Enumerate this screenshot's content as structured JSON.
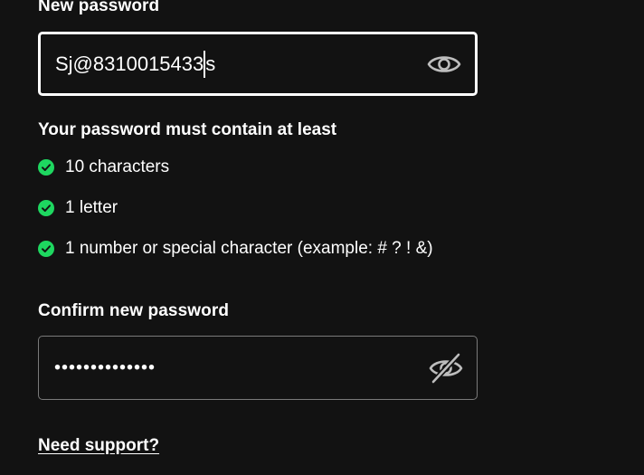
{
  "new_password": {
    "label": "New password",
    "value_before_caret": "Sj@8310015433",
    "value_after_caret": "s",
    "toggle_icon": "eye-icon"
  },
  "requirements": {
    "heading": "Your password must contain at least",
    "items": [
      {
        "label": "10 characters",
        "met": true
      },
      {
        "label": "1 letter",
        "met": true
      },
      {
        "label": "1 number or special character (example: # ? ! &)",
        "met": true
      }
    ],
    "check_color": "#1ed760"
  },
  "confirm_password": {
    "label": "Confirm new password",
    "masked_value": "••••••••••••••",
    "toggle_icon": "eye-off-icon"
  },
  "support": {
    "link_text": "Need support?"
  }
}
